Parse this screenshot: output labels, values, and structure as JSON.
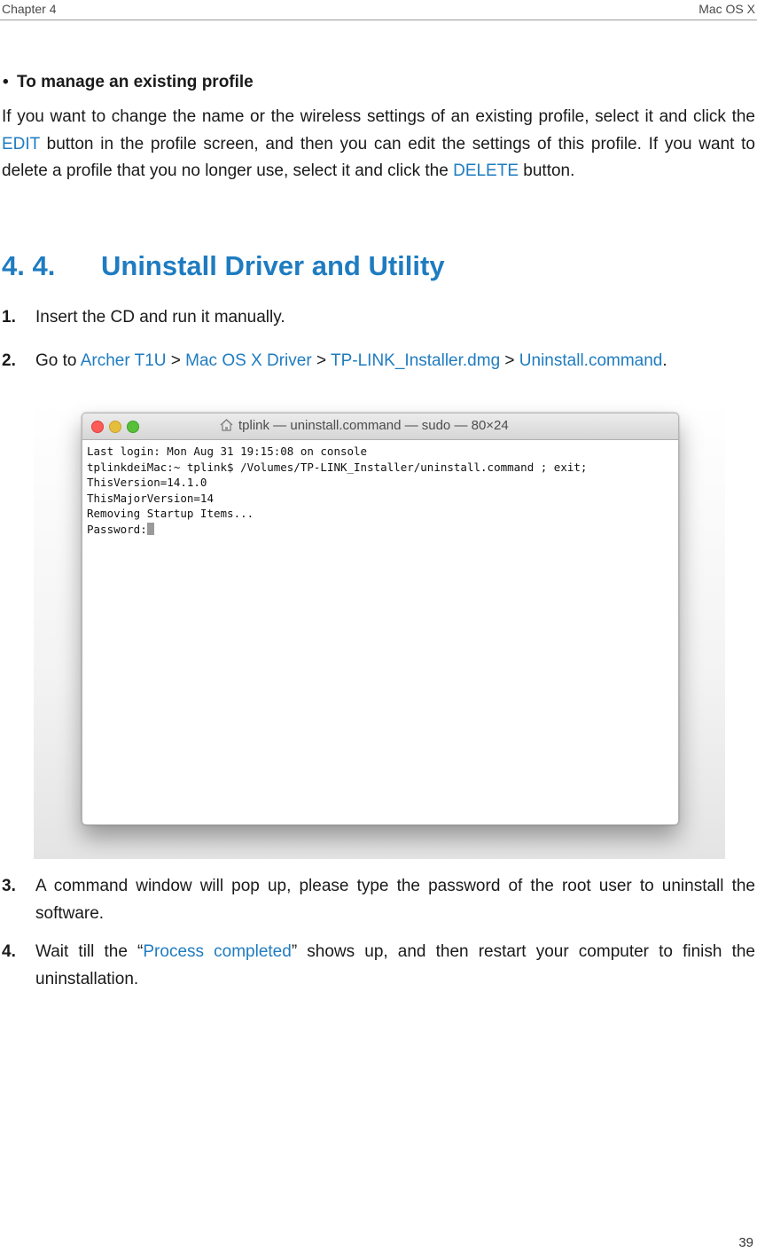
{
  "header": {
    "chapter": "Chapter 4",
    "section": "Mac OS X"
  },
  "bullet": {
    "symbol": "•",
    "heading": "To manage an existing profile"
  },
  "paragraph": {
    "p1": "If you want to change the name or the wireless settings of an existing profile, select it and click the ",
    "edit": "EDIT",
    "p2": " button in the profile screen, and then you can edit the settings of this profile. If you want to delete a profile that you no longer use, select it and click the ",
    "delete": "DELETE",
    "p3": " button."
  },
  "section": {
    "number": "4. 4.",
    "title": "Uninstall Driver and Utility"
  },
  "steps": [
    {
      "num": "1.",
      "text": "Insert the CD and run it manually."
    },
    {
      "num": "2.",
      "prefix": "Go to ",
      "path": [
        "Archer T1U",
        "Mac OS X Driver",
        "TP-LINK_Installer.dmg",
        "Uninstall.command"
      ],
      "separator": " > ",
      "suffix": "."
    },
    {
      "num": "3.",
      "text": "A command window will pop up, please type the password of the root user to uninstall the software."
    },
    {
      "num": "4.",
      "prefix": "Wait till the “",
      "highlight": "Process completed",
      "suffix": "” shows up, and then restart your computer to finish the uninstallation."
    }
  ],
  "terminal": {
    "title": "tplink — uninstall.command — sudo — 80×24",
    "lines": [
      "Last login: Mon Aug 31 19:15:08 on console",
      "tplinkdeiMac:~ tplink$ /Volumes/TP-LINK_Installer/uninstall.command ; exit;",
      "ThisVersion=14.1.0",
      "ThisMajorVersion=14",
      "Removing Startup Items...",
      "Password:"
    ]
  },
  "page_number": "39",
  "colors": {
    "accent": "#1f7cc0",
    "text": "#1a1a1a"
  }
}
